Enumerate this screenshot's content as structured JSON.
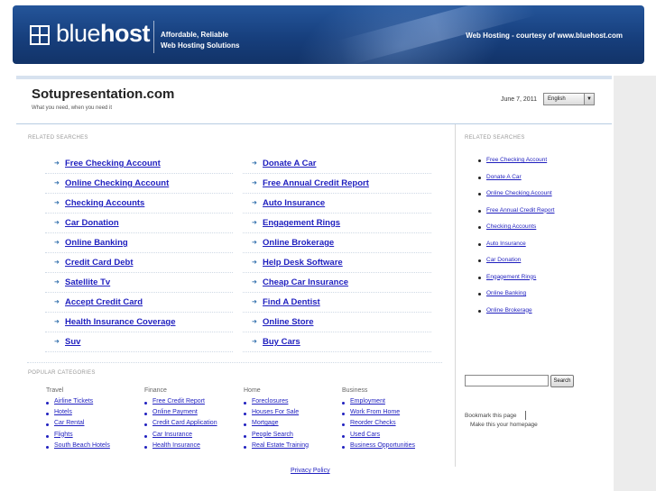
{
  "header": {
    "logo_part1": "blue",
    "logo_part2": "host",
    "tagline_line1": "Affordable, Reliable",
    "tagline_line2": "Web Hosting Solutions",
    "courtesy": "Web Hosting - courtesy of www.bluehost.com"
  },
  "site": {
    "title": "Sotupresentation.com",
    "subtitle": "What you need, when you need it",
    "date": "June 7, 2011",
    "language": "English"
  },
  "related": {
    "label": "RELATED SEARCHES",
    "rows": [
      [
        "Free Checking Account",
        "Donate A Car"
      ],
      [
        "Online Checking Account",
        "Free Annual Credit Report"
      ],
      [
        "Checking Accounts",
        "Auto Insurance"
      ],
      [
        "Car Donation",
        "Engagement Rings"
      ],
      [
        "Online Banking",
        "Online Brokerage"
      ],
      [
        "Credit Card Debt",
        "Help Desk Software"
      ],
      [
        "Satellite Tv",
        "Cheap Car Insurance"
      ],
      [
        "Accept Credit Card",
        "Find A Dentist"
      ],
      [
        "Health Insurance Coverage",
        "Online Store"
      ],
      [
        "Suv",
        "Buy Cars"
      ]
    ]
  },
  "sidebar": {
    "label": "RELATED SEARCHES",
    "items": [
      "Free Checking Account",
      "Donate A Car",
      "Online Checking Account",
      "Free Annual Credit Report",
      "Checking Accounts",
      "Auto Insurance",
      "Car Donation",
      "Engagement Rings",
      "Online Banking",
      "Online Brokerage"
    ],
    "search_button": "Search",
    "bookmark": "Bookmark this page",
    "homepage": "Make this your homepage"
  },
  "popular": {
    "label": "POPULAR CATEGORIES",
    "columns": [
      {
        "title": "Travel",
        "items": [
          "Airline Tickets",
          "Hotels",
          "Car Rental",
          "Flights",
          "South Beach Hotels"
        ]
      },
      {
        "title": "Finance",
        "items": [
          "Free Credit Report",
          "Online Payment",
          "Credit Card Application",
          "Car Insurance",
          "Health Insurance"
        ]
      },
      {
        "title": "Home",
        "items": [
          "Foreclosures",
          "Houses For Sale",
          "Mortgage",
          "People Search",
          "Real Estate Training"
        ]
      },
      {
        "title": "Business",
        "items": [
          "Employment",
          "Work From Home",
          "Reorder Checks",
          "Used Cars",
          "Business Opportunities"
        ]
      }
    ]
  },
  "footer": {
    "privacy": "Privacy Policy"
  }
}
